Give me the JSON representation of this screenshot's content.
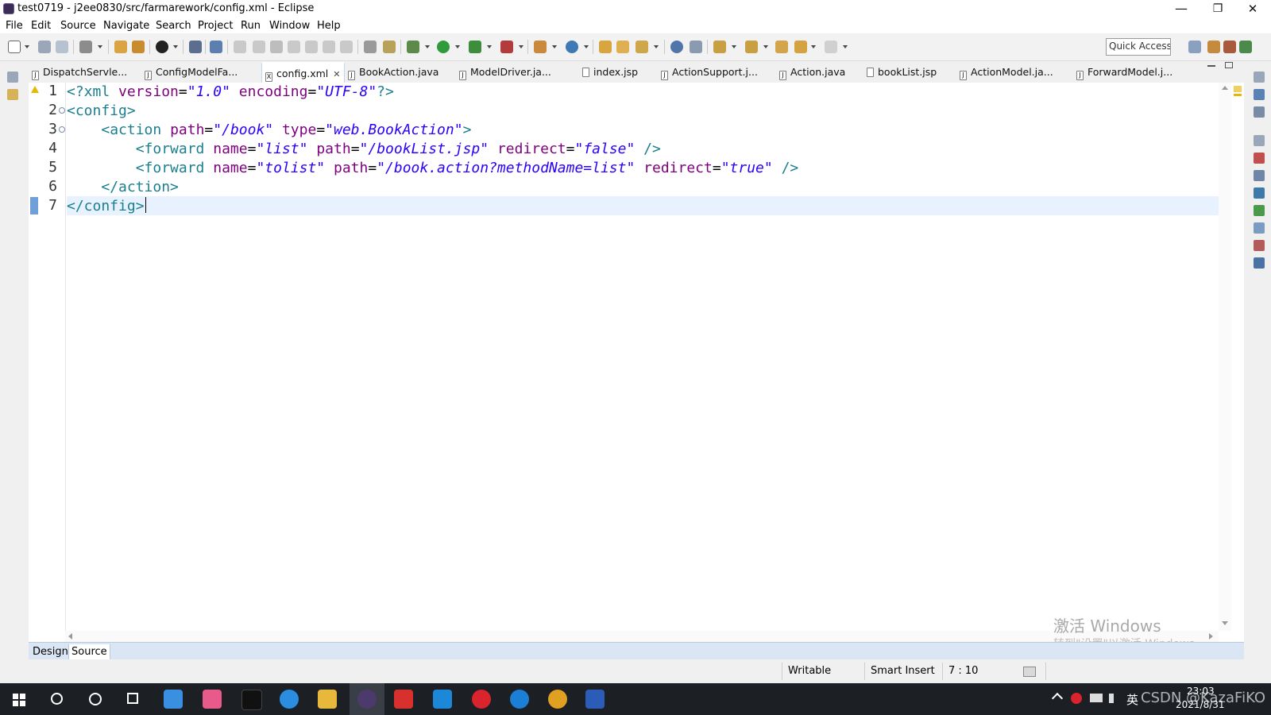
{
  "window": {
    "title": "test0719 - j2ee0830/src/farmarework/config.xml - Eclipse",
    "minimize": "—",
    "restore": "❐",
    "close": "✕"
  },
  "menu": [
    "File",
    "Edit",
    "Source",
    "Navigate",
    "Search",
    "Project",
    "Run",
    "Window",
    "Help"
  ],
  "toolbar": {
    "quick_access": "Quick Access"
  },
  "tabs": [
    {
      "label": "DispatchServle...",
      "icon": "J"
    },
    {
      "label": "ConfigModelFa...",
      "icon": "J"
    },
    {
      "label": "config.xml",
      "icon": "X",
      "active": true
    },
    {
      "label": "BookAction.java",
      "icon": "J"
    },
    {
      "label": "ModelDriver.ja...",
      "icon": "J"
    },
    {
      "label": "index.jsp",
      "icon": ""
    },
    {
      "label": "ActionSupport.j...",
      "icon": "J"
    },
    {
      "label": "Action.java",
      "icon": "J"
    },
    {
      "label": "bookList.jsp",
      "icon": ""
    },
    {
      "label": "ActionModel.ja...",
      "icon": "J"
    },
    {
      "label": "ForwardModel.j...",
      "icon": "J"
    }
  ],
  "editor": {
    "line_numbers": [
      "1",
      "2",
      "3",
      "4",
      "5",
      "6",
      "7"
    ],
    "lines": {
      "l1": {
        "a": "<?xml ",
        "b": "version",
        "c": "=",
        "d": "\"1.0\"",
        "e": " ",
        "f": "encoding",
        "g": "=",
        "h": "\"UTF-8\"",
        "i": "?>"
      },
      "l2": {
        "a": "<config>"
      },
      "l3": {
        "indent": "    ",
        "a": "<action ",
        "b": "path",
        "c": "=",
        "d": "\"/book\"",
        "e": " ",
        "f": "type",
        "g": "=",
        "h": "\"web.BookAction\"",
        "i": ">"
      },
      "l4": {
        "indent": "        ",
        "a": "<forward ",
        "b": "name",
        "c": "=",
        "d": "\"list\"",
        "e": " ",
        "f": "path",
        "g": "=",
        "h": "\"/bookList.jsp\"",
        "j": " ",
        "k": "redirect",
        "l": "=",
        "m": "\"false\"",
        "n": " />"
      },
      "l5": {
        "indent": "        ",
        "a": "<forward ",
        "b": "name",
        "c": "=",
        "d": "\"tolist\"",
        "e": " ",
        "f": "path",
        "g": "=",
        "h": "\"/book.action?methodName=list\"",
        "j": " ",
        "k": "redirect",
        "l": "=",
        "m": "\"true\"",
        "n": " />"
      },
      "l6": {
        "indent": "    ",
        "a": "</action>"
      },
      "l7": {
        "a": "</config>"
      }
    }
  },
  "bottom_tabs": {
    "design": "Design",
    "source": "Source"
  },
  "status": {
    "writable": "Writable",
    "insert_mode": "Smart Insert",
    "position": "7 : 10"
  },
  "watermark": {
    "line1": "激活 Windows",
    "line2": "转到\"设置\"以激活 Windows。"
  },
  "tray": {
    "ime": "英",
    "time": "23:03",
    "date": "2021/8/31",
    "overlay": "CSDN @KazaFiKO"
  },
  "colors": {
    "tag": "#1a7f8e",
    "attribute": "#7f007f",
    "value": "#2a00ff",
    "current_line": "#e8f2fe"
  }
}
